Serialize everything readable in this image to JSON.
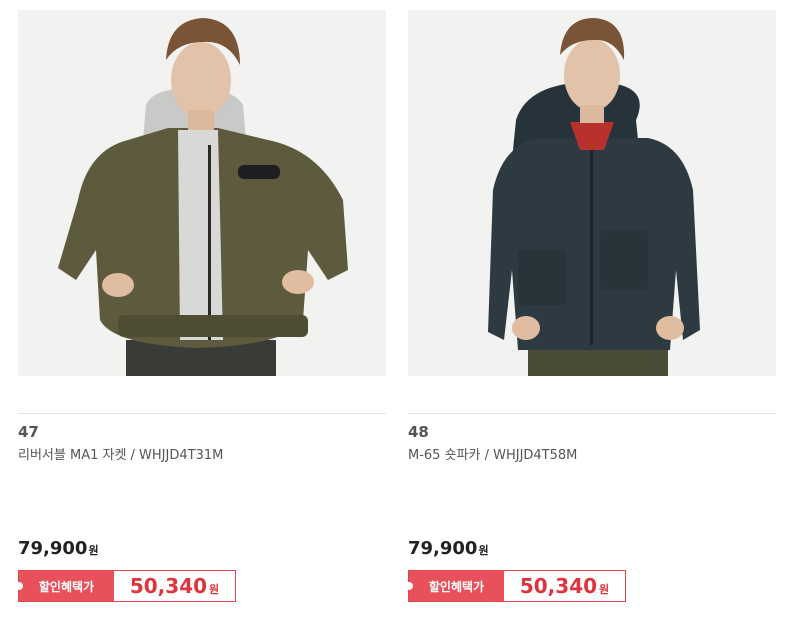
{
  "products": [
    {
      "rank": "47",
      "name": "리버서블 MA1 자켓 / WHJJD4T31M",
      "price": "79,900",
      "currency": "원",
      "benefit_label": "할인혜택가",
      "sale_price": "50,340",
      "image_subject": "olive bomber jacket with grey hood",
      "jacket_color": "#5d5a3e"
    },
    {
      "rank": "48",
      "name": "M-65 숏파카 / WHJJD4T58M",
      "price": "79,900",
      "currency": "원",
      "benefit_label": "할인혜택가",
      "sale_price": "50,340",
      "image_subject": "navy hooded short parka",
      "jacket_color": "#2e3a42"
    }
  ],
  "colors": {
    "accent_red": "#e0454e",
    "sale_text": "#e0333d",
    "image_bg": "#f2f2f0"
  }
}
